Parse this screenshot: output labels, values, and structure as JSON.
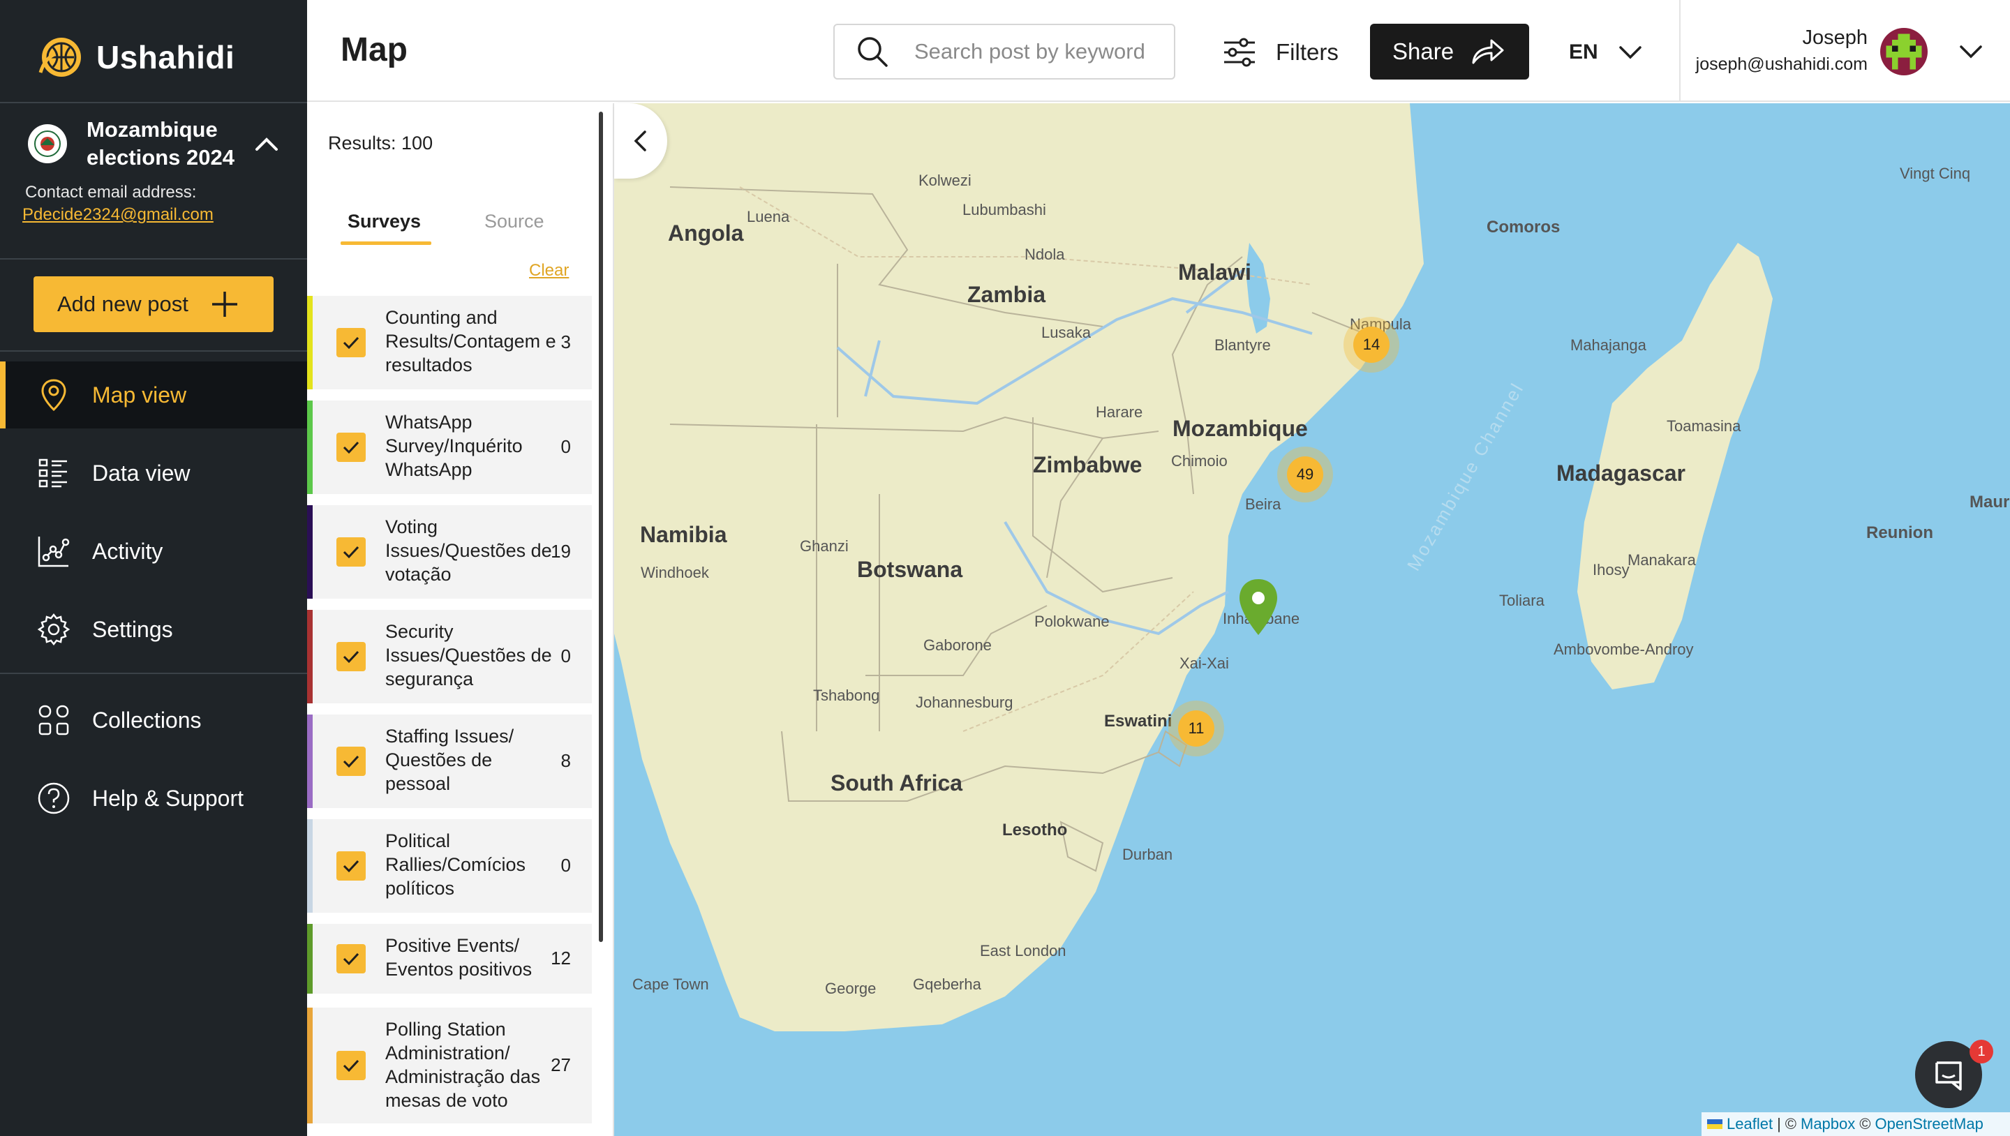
{
  "app": {
    "name": "Ushahidi"
  },
  "deployment": {
    "name": "Mozambique elections 2024",
    "contact_label": "Contact email address:",
    "contact_email": "Pdecide2324@gmail.com"
  },
  "sidebar": {
    "add_post_label": "Add new post",
    "items": [
      {
        "label": "Map view",
        "icon": "map-pin-icon",
        "active": true
      },
      {
        "label": "Data view",
        "icon": "list-icon"
      },
      {
        "label": "Activity",
        "icon": "activity-chart-icon"
      },
      {
        "label": "Settings",
        "icon": "gear-icon"
      },
      {
        "label": "Collections",
        "icon": "grid-icon"
      },
      {
        "label": "Help & Support",
        "icon": "help-circle-icon"
      }
    ]
  },
  "header": {
    "title": "Map",
    "search_placeholder": "Search post by keyword",
    "filters_label": "Filters",
    "share_label": "Share",
    "language": "EN",
    "user_name": "Joseph",
    "user_email": "joseph@ushahidi.com"
  },
  "panel": {
    "results": "Results: 100",
    "tabs": [
      "Surveys",
      "Source"
    ],
    "clear_label": "Clear",
    "surveys": [
      {
        "name": "Counting and Results/Contagem e resultados",
        "count": "3",
        "color": "#e4e31c"
      },
      {
        "name": "WhatsApp Survey/Inquérito WhatsApp",
        "count": "0",
        "color": "#5cc84a"
      },
      {
        "name": "Voting Issues/Questões de votação",
        "count": "19",
        "color": "#2a0f55"
      },
      {
        "name": "Security Issues/Questões de segurança",
        "count": "0",
        "color": "#a83232"
      },
      {
        "name": "Staffing Issues/ Questões de pessoal",
        "count": "8",
        "color": "#9a6cc4"
      },
      {
        "name": "Political Rallies/Comícios políticos",
        "count": "0",
        "color": "#c8d6e4"
      },
      {
        "name": "Positive Events/ Eventos positivos",
        "count": "12",
        "color": "#5e9b2a"
      },
      {
        "name": "Polling Station Administration/ Administração das mesas de voto",
        "count": "27",
        "color": "#e8a53a"
      }
    ]
  },
  "map": {
    "countries": [
      "Angola",
      "Zambia",
      "Malawi",
      "Comoros",
      "Mozambique",
      "Zimbabwe",
      "Namibia",
      "Botswana",
      "Madagascar",
      "South Africa",
      "Lesotho",
      "Eswatini",
      "Mauritius",
      "Reunion"
    ],
    "places": [
      "Luena",
      "Kolwezi",
      "Lubumbashi",
      "Ndola",
      "Lusaka",
      "Blantyre",
      "Nampula",
      "Mahajanga",
      "Harare",
      "Chimoio",
      "Beira",
      "Toamasina",
      "Windhoek",
      "Ghanzi",
      "Gaborone",
      "Polokwane",
      "Inhambane",
      "Xai-Xai",
      "Tshabong",
      "Johannesburg",
      "Durban",
      "East London",
      "Cape Town",
      "George",
      "Gqeberha",
      "Toliara",
      "Ihosy",
      "Manakara",
      "Ambovombe-Androy",
      "Vingt Cinq"
    ],
    "sea_label": "Mozambique Channel",
    "clusters": [
      "14",
      "49",
      "11"
    ],
    "pin_color": "#6aab2e"
  },
  "attribution": {
    "leaflet": "Leaflet",
    "mapbox": "Mapbox",
    "osm": "OpenStreetMap",
    "sep": "|",
    "copy": "©"
  },
  "chat": {
    "badge": "1"
  }
}
